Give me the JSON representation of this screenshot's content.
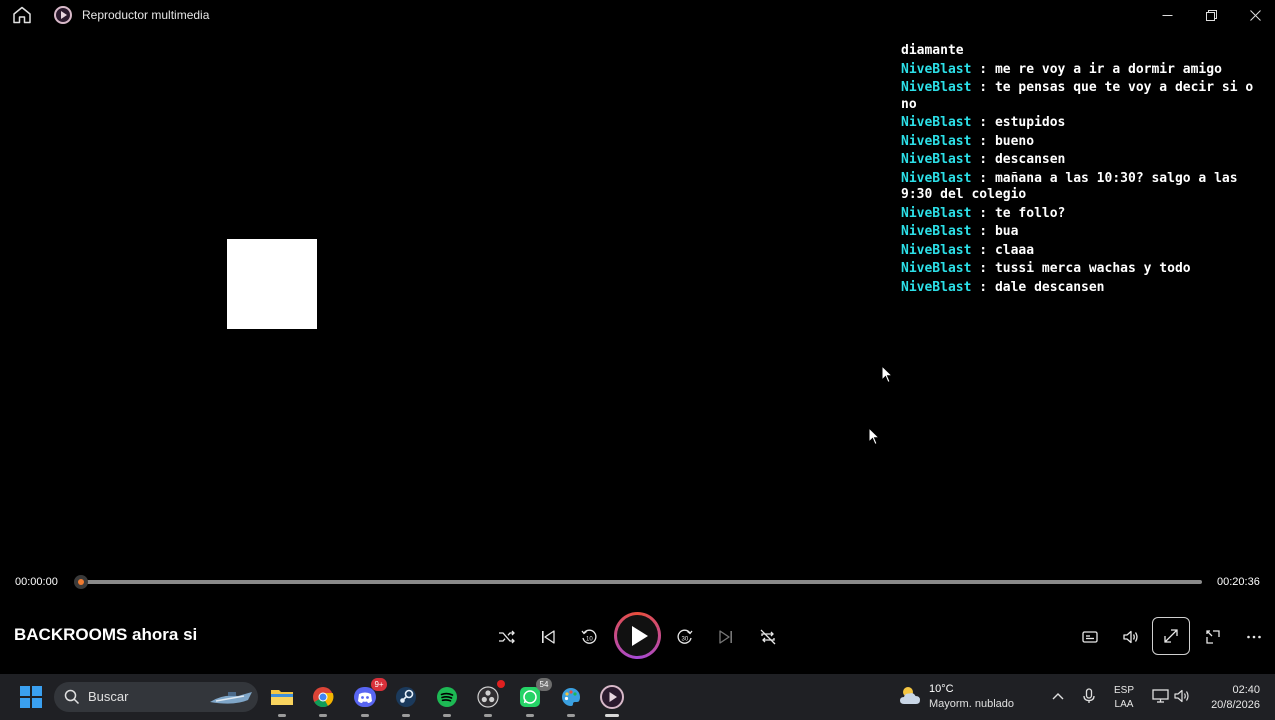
{
  "window": {
    "title": "Reproductor multimedia"
  },
  "chat": {
    "lines": [
      {
        "user": "",
        "sep": "",
        "text": "diamante"
      },
      {
        "user": "NiveBlast",
        "sep": " : ",
        "text": "me re voy a ir a dormir amigo"
      },
      {
        "user": "NiveBlast",
        "sep": " : ",
        "text": "te pensas que te voy a decir si o no"
      },
      {
        "user": "NiveBlast",
        "sep": " : ",
        "text": "estupidos"
      },
      {
        "user": "NiveBlast",
        "sep": " : ",
        "text": "bueno"
      },
      {
        "user": "NiveBlast",
        "sep": " : ",
        "text": "descansen"
      },
      {
        "user": "NiveBlast",
        "sep": " : ",
        "text": "mañana a las 10:30? salgo a las 9:30 del colegio"
      },
      {
        "user": "NiveBlast",
        "sep": " : ",
        "text": "te follo?"
      },
      {
        "user": "NiveBlast",
        "sep": " : ",
        "text": "bua"
      },
      {
        "user": "NiveBlast",
        "sep": " : ",
        "text": "claaa"
      },
      {
        "user": "NiveBlast",
        "sep": " : ",
        "text": "tussi merca wachas y todo"
      },
      {
        "user": "NiveBlast",
        "sep": " : ",
        "text": "dale descansen"
      }
    ]
  },
  "player": {
    "current_time": "00:00:00",
    "total_time": "00:20:36",
    "progress": 0,
    "media_title": "BACKROOMS ahora si",
    "accent_color": "#f07a2f"
  },
  "taskbar": {
    "search_placeholder": "Buscar",
    "discord_badge": "9+",
    "whatsapp_badge": "54",
    "weather_temp": "10°C",
    "weather_desc": "Mayorm. nublado",
    "lang_line1": "ESP",
    "lang_line2": "LAA",
    "time": "02:40",
    "date": "20/8/2026"
  }
}
